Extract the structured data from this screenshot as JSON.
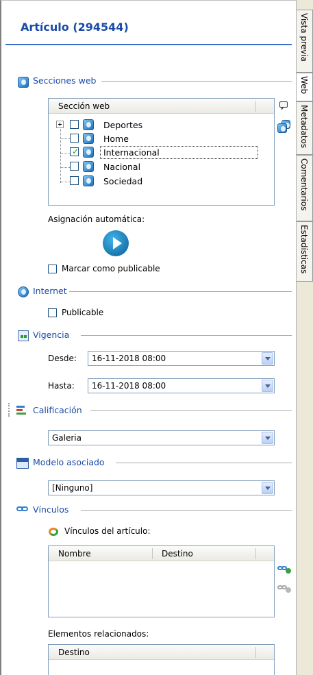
{
  "header": {
    "title": "Artículo (294544)"
  },
  "tabs": [
    {
      "label": "Vista previa",
      "active": false
    },
    {
      "label": "Web",
      "active": true
    },
    {
      "label": "Metadatos",
      "active": false
    },
    {
      "label": "Comentarios",
      "active": false
    },
    {
      "label": "Estadísticas",
      "active": false
    }
  ],
  "secciones": {
    "label": "Secciones web",
    "column": "Sección web",
    "items": [
      {
        "label": "Deportes",
        "checked": false,
        "expandable": true
      },
      {
        "label": "Home",
        "checked": false
      },
      {
        "label": "Internacional",
        "checked": true,
        "selected": true
      },
      {
        "label": "Nacional",
        "checked": false
      },
      {
        "label": "Sociedad",
        "checked": false
      }
    ],
    "auto_label": "Asignación automática:",
    "publicable_label": "Marcar como publicable"
  },
  "internet": {
    "label": "Internet",
    "publicable_label": "Publicable"
  },
  "vigencia": {
    "label": "Vigencia",
    "desde_label": "Desde:",
    "desde_value": "16-11-2018 08:00",
    "hasta_label": "Hasta:",
    "hasta_value": "16-11-2018 08:00"
  },
  "calificacion": {
    "label": "Calificación",
    "value": "Galeria"
  },
  "modelo": {
    "label": "Modelo asociado",
    "value": "[Ninguno]"
  },
  "vinculos": {
    "label": "Vínculos",
    "sub_label": "Vínculos del artículo:",
    "columns": [
      "Nombre",
      "Destino"
    ],
    "related_label": "Elementos relacionados:",
    "related_columns": [
      "Destino"
    ]
  },
  "colors": {
    "accent": "#1a4aa6",
    "check": "#21a121",
    "border": "#7f9db9"
  }
}
